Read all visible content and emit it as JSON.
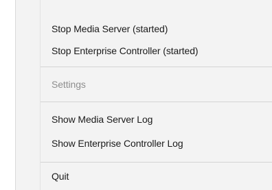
{
  "menu": {
    "items": [
      {
        "label": "Stop Media Server (started)",
        "enabled": true
      },
      {
        "label": "Stop Enterprise Controller (started)",
        "enabled": true
      },
      {
        "label": "Settings",
        "enabled": false
      },
      {
        "label": "Show Media Server Log",
        "enabled": true
      },
      {
        "label": "Show Enterprise Controller Log",
        "enabled": true
      },
      {
        "label": "Quit",
        "enabled": true
      }
    ]
  }
}
